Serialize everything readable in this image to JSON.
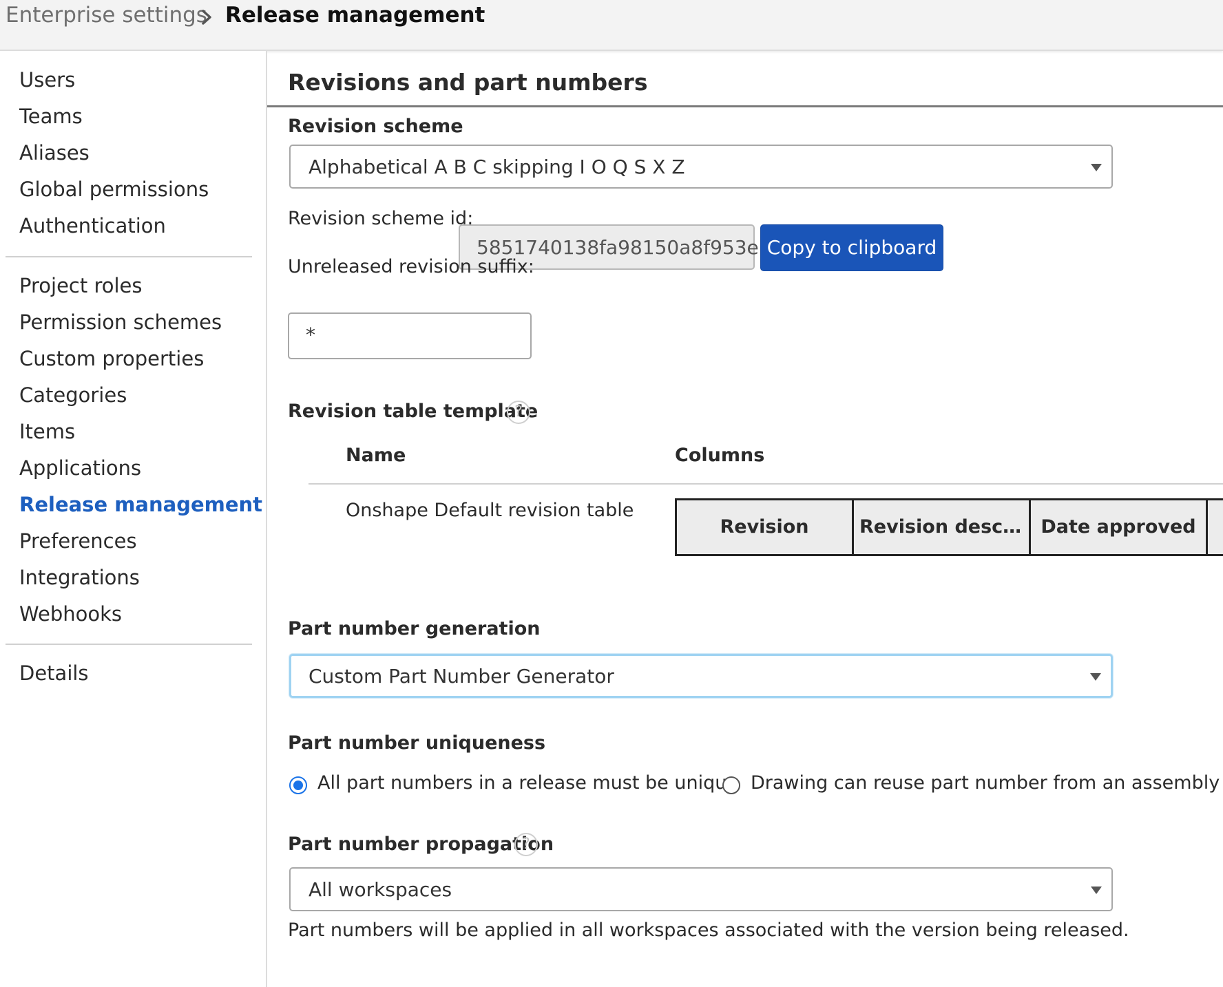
{
  "breadcrumb": {
    "parent": "Enterprise settings",
    "current": "Release management"
  },
  "sidebar": {
    "groups": [
      [
        "Users",
        "Teams",
        "Aliases",
        "Global permissions",
        "Authentication"
      ],
      [
        "Project roles",
        "Permission schemes",
        "Custom properties",
        "Categories",
        "Items",
        "Applications",
        "Release management",
        "Preferences",
        "Integrations",
        "Webhooks"
      ],
      [
        "Details"
      ]
    ],
    "active": "Release management"
  },
  "main": {
    "section_title": "Revisions and part numbers",
    "revision_scheme": {
      "label": "Revision scheme",
      "selected": "Alphabetical A B C skipping I O Q S X Z"
    },
    "scheme_id": {
      "label": "Revision scheme id:",
      "value": "5851740138fa98150a8f953e",
      "copy_label": "Copy to clipboard"
    },
    "unreleased_suffix": {
      "label": "Unreleased revision suffix:",
      "value": "*"
    },
    "revision_table_template": {
      "label": "Revision table template",
      "help": "?",
      "headers": {
        "name": "Name",
        "columns": "Columns"
      },
      "rows": [
        {
          "name": "Onshape Default revision table",
          "columns": [
            "Revision",
            "Revision descrip…",
            "Date approved"
          ]
        }
      ]
    },
    "part_number_generation": {
      "label": "Part number generation",
      "selected": "Custom Part Number Generator"
    },
    "part_number_uniqueness": {
      "label": "Part number uniqueness",
      "options": [
        {
          "label": "All part numbers in a release must be unique",
          "checked": true
        },
        {
          "label": "Drawing can reuse part number from an assembly or pa",
          "checked": false
        }
      ]
    },
    "part_number_propagation": {
      "label": "Part number propagation",
      "help": "?",
      "selected": "All workspaces",
      "helper_text": "Part numbers will be applied in all workspaces associated with the version being released."
    }
  },
  "colors": {
    "accent": "#1a55b8",
    "active_nav": "#1d5fbf",
    "radio_checked": "#1a73e8",
    "focus_ring": "#9fd3f2"
  },
  "icons": {
    "breadcrumb_separator": "chevron-right-icon",
    "help": "question-circle-icon",
    "dropdown": "caret-down-icon"
  }
}
